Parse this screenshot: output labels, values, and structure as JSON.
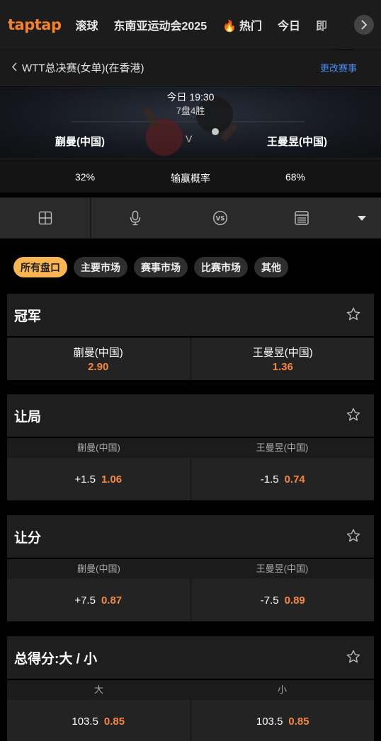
{
  "nav": {
    "logo": "taptap",
    "items": [
      "滚球",
      "东南亚运动会2025",
      "热门",
      "今日",
      "即"
    ]
  },
  "breadcrumb": {
    "back": "<",
    "title": "WTT总决赛(女单)(在香港)",
    "change": "更改赛事"
  },
  "match": {
    "time": "今日 19:30",
    "format": "7盘4胜",
    "home": "蒯曼(中国)",
    "away": "王曼昱(中国)",
    "vs": "V",
    "home_prob": "32%",
    "prob_label": "输赢概率",
    "away_prob": "68%"
  },
  "toolbar": {
    "icons": [
      "layout-grid-icon",
      "microphone-icon",
      "versus-icon",
      "scoreboard-icon",
      "dropdown-caret-icon"
    ]
  },
  "filters": [
    "所有盘口",
    "主要市场",
    "赛事市场",
    "比赛市场",
    "其他"
  ],
  "markets": {
    "winner": {
      "title": "冠军",
      "home_name": "蒯曼(中国)",
      "home_price": "2.90",
      "away_name": "王曼昱(中国)",
      "away_price": "1.36"
    },
    "game_handicap": {
      "title": "让局",
      "home_label": "蒯曼(中国)",
      "away_label": "王曼昱(中国)",
      "home_line": "+1.5",
      "home_price": "1.06",
      "away_line": "-1.5",
      "away_price": "0.74"
    },
    "point_handicap": {
      "title": "让分",
      "home_label": "蒯曼(中国)",
      "away_label": "王曼昱(中国)",
      "home_line": "+7.5",
      "home_price": "0.87",
      "away_line": "-7.5",
      "away_price": "0.89"
    },
    "total_points": {
      "title": "总得分:大 / 小",
      "over_label": "大",
      "under_label": "小",
      "over_line": "103.5",
      "over_price": "0.85",
      "under_line": "103.5",
      "under_price": "0.85"
    }
  },
  "colors": {
    "accent": "#f5822a",
    "odds": "#f5883e",
    "link": "#4a8cf0",
    "active_chip": "#f8b552"
  }
}
